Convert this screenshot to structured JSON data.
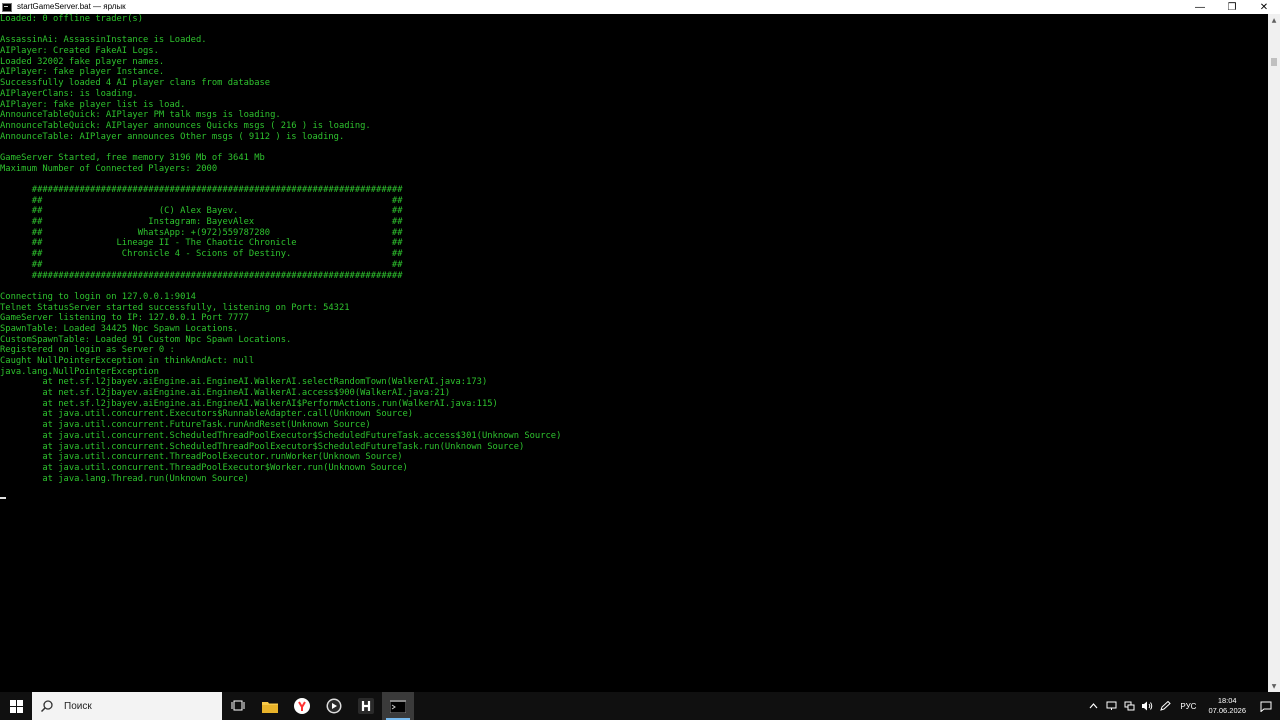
{
  "window": {
    "title": "startGameServer.bat — ярлык",
    "minimize_glyph": "—",
    "restore_glyph": "❐",
    "close_glyph": "✕"
  },
  "console": {
    "text_color": "#2ec32e",
    "lines": [
      "Loaded: 0 offline trader(s)",
      "",
      "AssassinAi: AssassinInstance is Loaded.",
      "AIPlayer: Created FakeAI Logs.",
      "Loaded 32002 fake player names.",
      "AIPlayer: fake player Instance.",
      "Successfully loaded 4 AI player clans from database",
      "AIPlayerClans: is loading.",
      "AIPlayer: fake player list is load.",
      "AnnounceTableQuick: AIPlayer PM talk msgs is loading.",
      "AnnounceTableQuick: AIPlayer announces Quicks msgs ( 216 ) is loading.",
      "AnnounceTable: AIPlayer announces Other msgs ( 9112 ) is loading.",
      "",
      "GameServer Started, free memory 3196 Mb of 3641 Mb",
      "Maximum Number of Connected Players: 2000",
      "",
      "      ######################################################################",
      "      ##                                                                  ##",
      "      ##                      (C) Alex Bayev.                             ##",
      "      ##                    Instagram: BayevAlex                          ##",
      "      ##                  WhatsApp: +(972)559787280                       ##",
      "      ##              Lineage II - The Chaotic Chronicle                  ##",
      "      ##               Chronicle 4 - Scions of Destiny.                   ##",
      "      ##                                                                  ##",
      "      ######################################################################",
      "",
      "Connecting to login on 127.0.0.1:9014",
      "Telnet StatusServer started successfully, listening on Port: 54321",
      "GameServer listening to IP: 127.0.0.1 Port 7777",
      "SpawnTable: Loaded 34425 Npc Spawn Locations.",
      "CustomSpawnTable: Loaded 91 Custom Npc Spawn Locations.",
      "Registered on login as Server 0 :",
      "Caught NullPointerException in thinkAndAct: null",
      "java.lang.NullPointerException",
      "        at net.sf.l2jbayev.aiEngine.ai.EngineAI.WalkerAI.selectRandomTown(WalkerAI.java:173)",
      "        at net.sf.l2jbayev.aiEngine.ai.EngineAI.WalkerAI.access$900(WalkerAI.java:21)",
      "        at net.sf.l2jbayev.aiEngine.ai.EngineAI.WalkerAI$PerformActions.run(WalkerAI.java:115)",
      "        at java.util.concurrent.Executors$RunnableAdapter.call(Unknown Source)",
      "        at java.util.concurrent.FutureTask.runAndReset(Unknown Source)",
      "        at java.util.concurrent.ScheduledThreadPoolExecutor$ScheduledFutureTask.access$301(Unknown Source)",
      "        at java.util.concurrent.ScheduledThreadPoolExecutor$ScheduledFutureTask.run(Unknown Source)",
      "        at java.util.concurrent.ThreadPoolExecutor.runWorker(Unknown Source)",
      "        at java.util.concurrent.ThreadPoolExecutor$Worker.run(Unknown Source)",
      "        at java.lang.Thread.run(Unknown Source)",
      ""
    ]
  },
  "taskbar": {
    "search_placeholder": "Поиск",
    "tray": {
      "language": "РУС",
      "time": "18:04",
      "date": "07.06.2026"
    }
  }
}
